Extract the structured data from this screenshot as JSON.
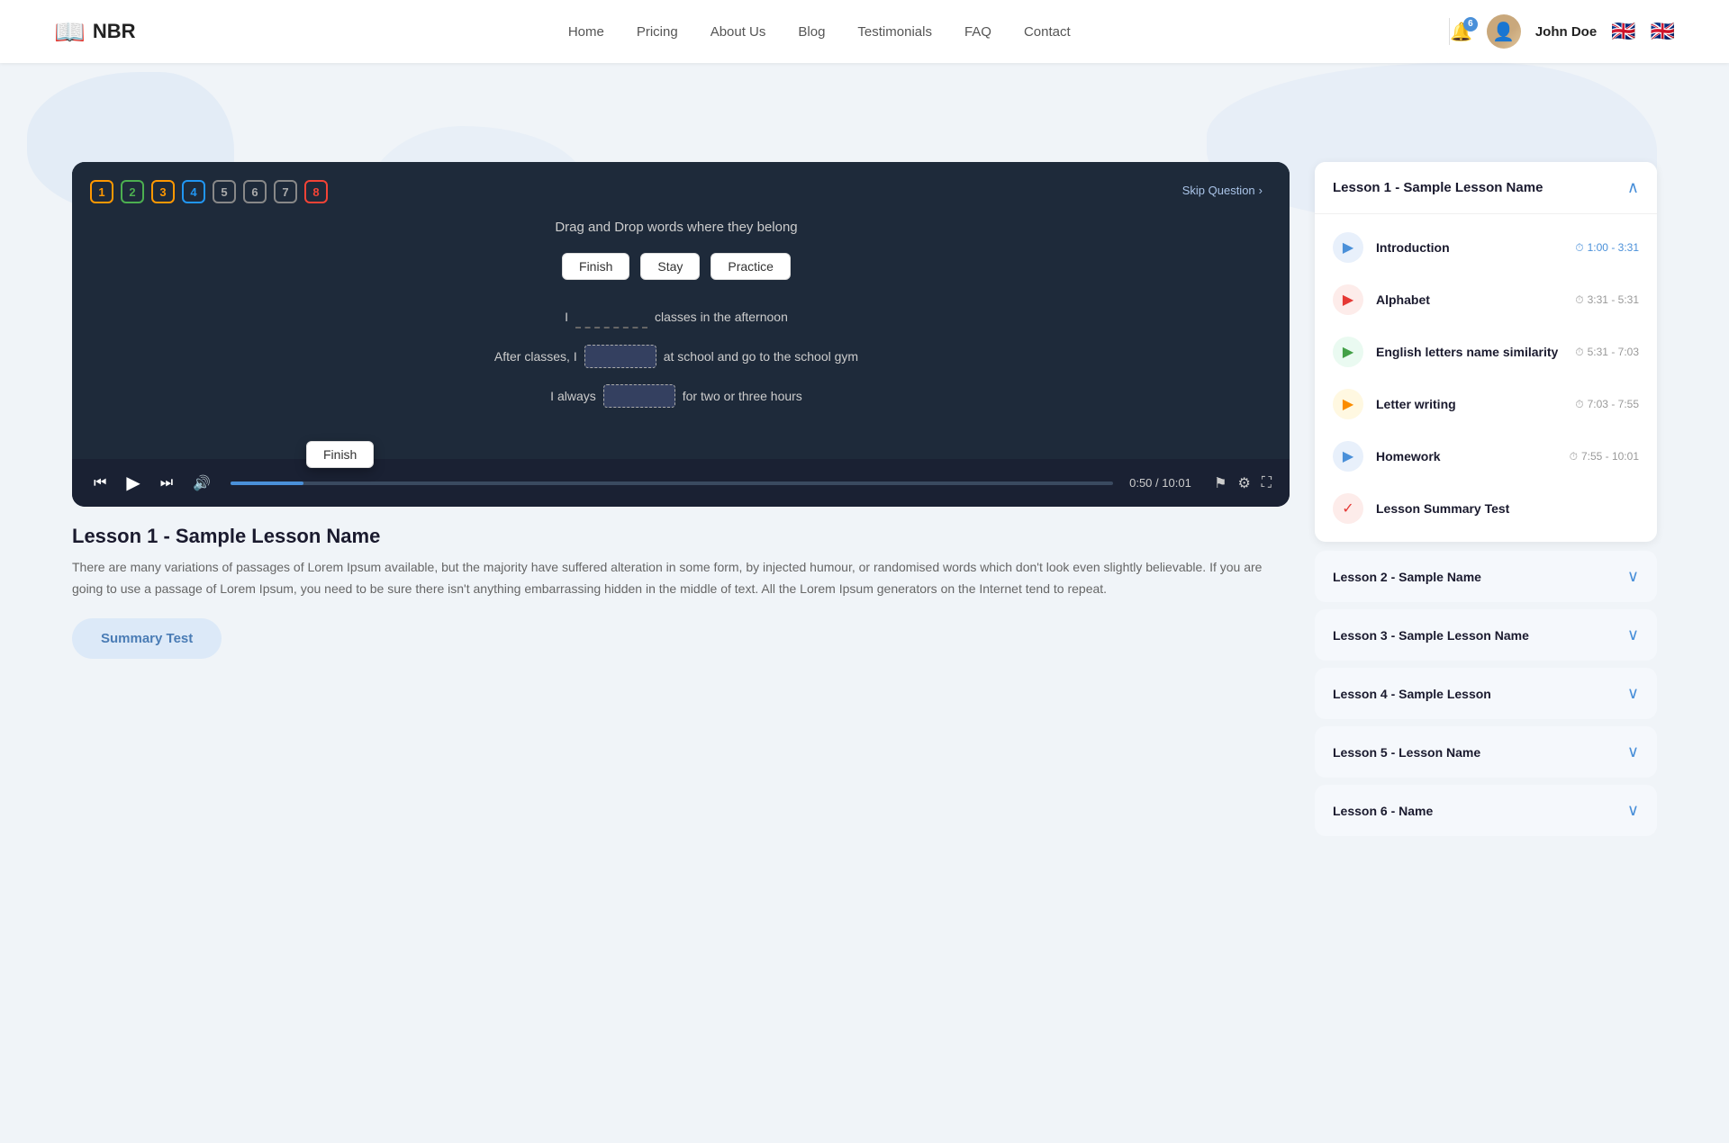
{
  "nav": {
    "logo_text": "NBR",
    "links": [
      "Home",
      "Pricing",
      "About Us",
      "Blog",
      "Testimonials",
      "FAQ",
      "Contact"
    ],
    "notification_count": "6",
    "user_name": "John Doe"
  },
  "quiz": {
    "title": "Drag and Drop words where they belong",
    "skip_label": "Skip Question",
    "question_numbers": [
      1,
      2,
      3,
      4,
      5,
      6,
      7,
      8
    ],
    "words": [
      "Finish",
      "Stay",
      "Practice"
    ],
    "dragging_word": "Finish",
    "sentences": [
      {
        "before": "I",
        "blank": "",
        "after": "classes in the afternoon"
      },
      {
        "before": "After classes, I",
        "blank": "",
        "after": "at school and go to the school gym"
      },
      {
        "before": "I always",
        "blank": "",
        "after": "for two or three hours"
      }
    ]
  },
  "video": {
    "current_time": "0:50",
    "total_time": "10:01",
    "progress_percent": 8.3
  },
  "lesson": {
    "title": "Lesson 1 - Sample Lesson Name",
    "description": "There are many variations of passages of Lorem Ipsum available, but the majority have suffered alteration in some form, by injected humour, or randomised words which don't look even slightly believable. If you are going to use a passage of Lorem Ipsum, you need to be sure there isn't anything embarrassing hidden in the middle of text. All the Lorem Ipsum generators on the Internet tend to repeat.",
    "summary_test_label": "Summary Test"
  },
  "sidebar": {
    "expanded_lesson": {
      "title": "Lesson 1 - Sample Lesson Name",
      "items": [
        {
          "name": "Introduction",
          "time": "1:00 - 3:31",
          "type": "play",
          "color": "blue",
          "highlighted": true
        },
        {
          "name": "Alphabet",
          "time": "3:31 - 5:31",
          "type": "play",
          "color": "red",
          "highlighted": false
        },
        {
          "name": "English letters name similarity",
          "time": "5:31 - 7:03",
          "type": "play",
          "color": "green",
          "highlighted": false
        },
        {
          "name": "Letter writing",
          "time": "7:03 - 7:55",
          "type": "play",
          "color": "yellow",
          "highlighted": false
        },
        {
          "name": "Homework",
          "time": "7:55 - 10:01",
          "type": "play",
          "color": "blue",
          "highlighted": false
        },
        {
          "name": "Lesson Summary Test",
          "time": "",
          "type": "test",
          "color": "red",
          "highlighted": false
        }
      ]
    },
    "collapsed_lessons": [
      {
        "title": "Lesson 2 - Sample Name"
      },
      {
        "title": "Lesson 3 - Sample Lesson Name"
      },
      {
        "title": "Lesson 4 - Sample Lesson"
      },
      {
        "title": "Lesson 5 - Lesson Name"
      },
      {
        "title": "Lesson 6 - Name"
      }
    ]
  }
}
